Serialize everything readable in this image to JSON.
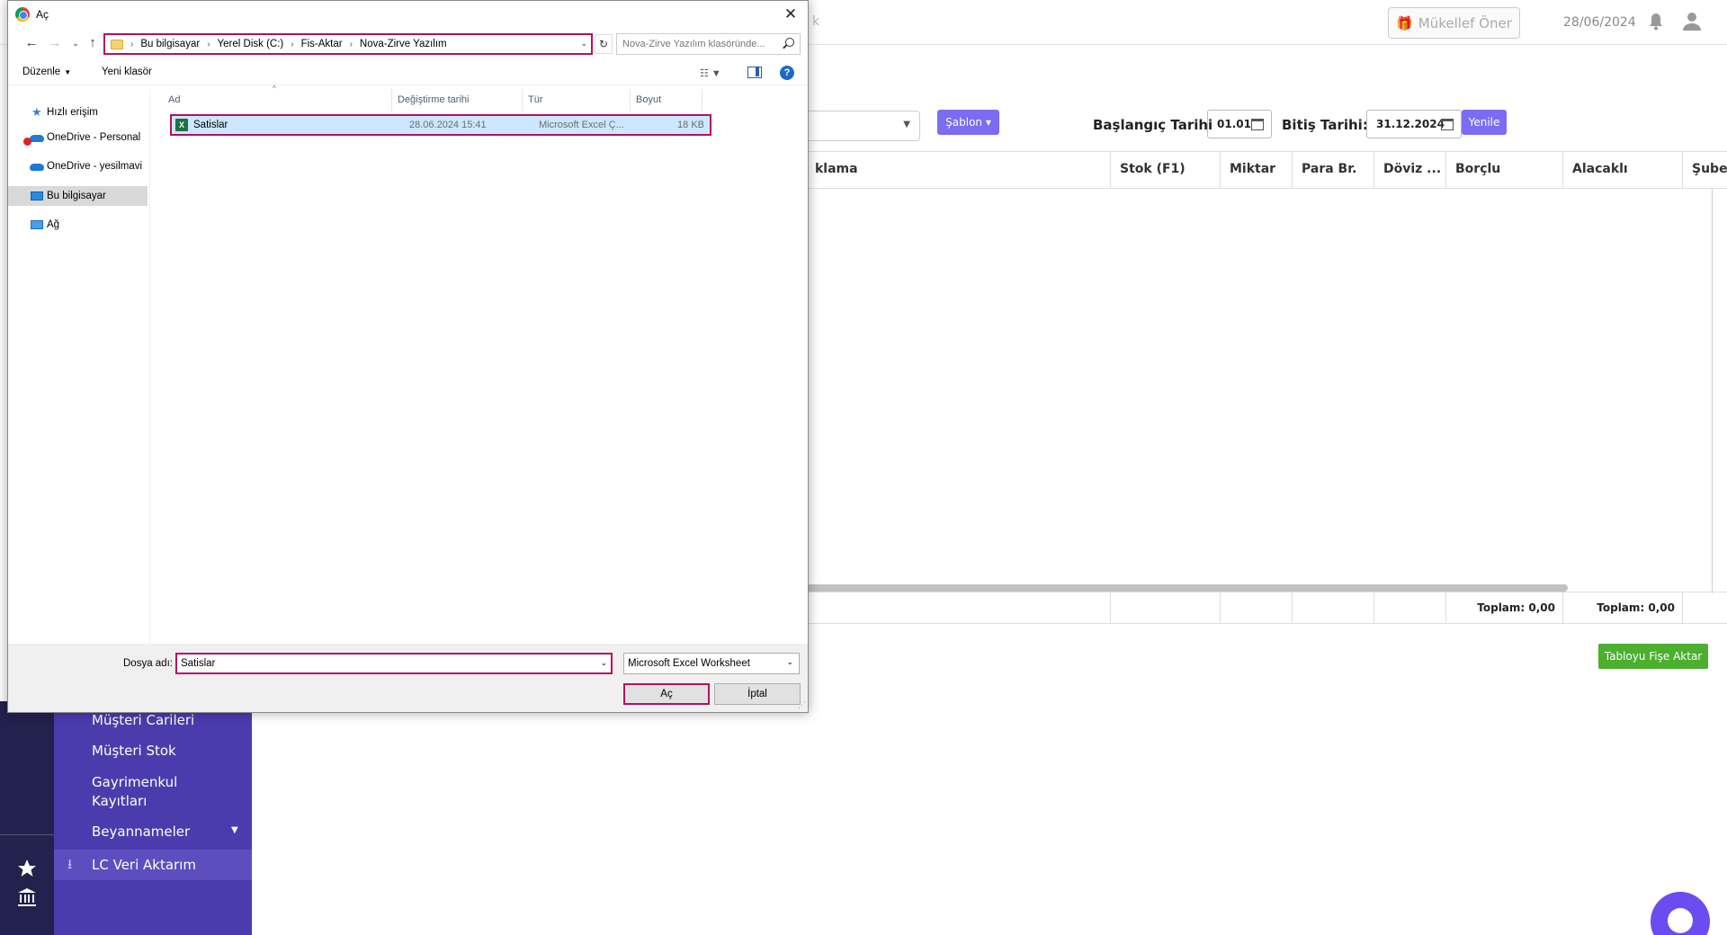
{
  "app": {
    "search_ghost": "k",
    "oner_label": "Mükellef Öner",
    "date": "28/06/2024",
    "sablon_label": "Şablon",
    "baslangic_label": "Başlangıç Tarihi",
    "baslangic_value": "01.01",
    "bitis_label": "Bitiş Tarihi:",
    "bitis_value": "31.12.2024",
    "yenile_label": "Yenile",
    "columns": [
      "klama",
      "Stok (F1)",
      "Miktar",
      "Para Br.",
      "Döviz ...",
      "Borçlu",
      "Alacaklı",
      "Şube"
    ],
    "footer_totals": [
      "Toplam: 0,00",
      "Toplam: 0,00"
    ],
    "aktar_label": "Tabloyu Fişe Aktar",
    "sidebar": [
      "Müşteri Carileri",
      "Müşteri Stok",
      "Gayrimenkul",
      "Kayıtları",
      "Beyannameler",
      "LC Veri Aktarım"
    ]
  },
  "dialog": {
    "title": "Aç",
    "breadcrumb": [
      "Bu bilgisayar",
      "Yerel Disk (C:)",
      "Fis-Aktar",
      "Nova-Zirve Yazılım"
    ],
    "search_placeholder": "Nova-Zirve Yazılım klasöründe...",
    "toolbar": {
      "organize": "Düzenle",
      "new_folder": "Yeni klasör"
    },
    "nav": [
      "Hızlı erişim",
      "OneDrive - Personal",
      "OneDrive - yesilmavi",
      "Bu bilgisayar",
      "Ağ"
    ],
    "columns": [
      "Ad",
      "Değiştirme tarihi",
      "Tür",
      "Boyut"
    ],
    "files": [
      {
        "name": "Satislar",
        "modified": "28.06.2024 15:41",
        "type": "Microsoft Excel Ç...",
        "size": "18 KB"
      }
    ],
    "filename_label": "Dosya adı:",
    "filename_value": "Satislar",
    "filetype": "Microsoft Excel Worksheet",
    "open_label": "Aç",
    "cancel_label": "İptal"
  },
  "colors": {
    "highlight": "#b5105f",
    "accent": "#7c6cf2",
    "sidebar": "#4b3cad",
    "success": "#4caf2e"
  }
}
